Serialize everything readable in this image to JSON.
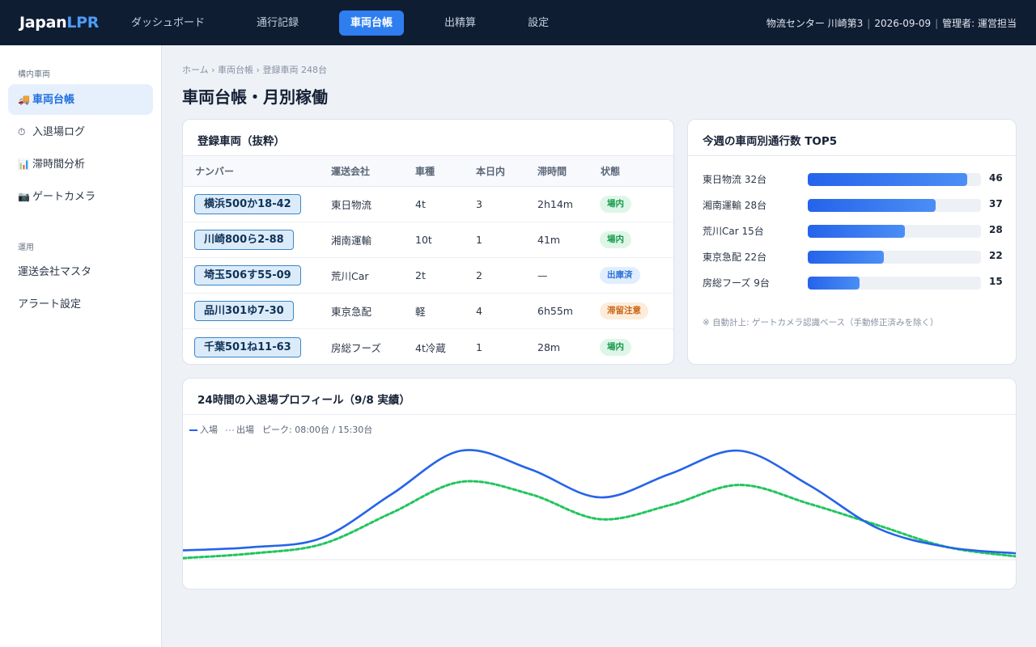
{
  "brand": {
    "prefix": "Japan",
    "accent": "LPR"
  },
  "nav": [
    {
      "label": "ダッシュボード",
      "active": false
    },
    {
      "label": "通行記録",
      "active": false
    },
    {
      "label": "車両台帳",
      "active": true
    },
    {
      "label": "出精算",
      "active": false
    },
    {
      "label": "設定",
      "active": false
    }
  ],
  "topmeta": {
    "site": "物流センター 川崎第3",
    "sep": "|",
    "date": "2026-09-09",
    "user": "管理者: 運営担当"
  },
  "sidebar": {
    "section1": "構内車両",
    "items1": [
      {
        "icon": "🚚",
        "icon_name": "truck-icon",
        "label": "車両台帳",
        "active": true
      },
      {
        "icon": "⏱",
        "icon_name": "timer-icon",
        "label": "入退場ログ",
        "active": false
      },
      {
        "icon": "📊",
        "icon_name": "bar-chart-icon",
        "label": "滞時間分析",
        "active": false
      },
      {
        "icon": "📷",
        "icon_name": "camera-icon",
        "label": "ゲートカメラ",
        "active": false
      }
    ],
    "section2": "運用",
    "items2": [
      {
        "label": "運送会社マスタ"
      },
      {
        "label": "アラート設定"
      }
    ]
  },
  "breadcrumb": "ホーム › 車両台帳 › 登録車両 248台",
  "page_title": "車両台帳・月別稼働",
  "vehicles": {
    "title": "登録車両（抜粋）",
    "columns": [
      "ナンバー",
      "運送会社",
      "車種",
      "本日内",
      "滞時間",
      "状態"
    ],
    "rows": [
      {
        "plate": "横浜500か18-42",
        "company": "東日物流",
        "type": "4t",
        "today": "3",
        "dwell": "2h14m",
        "status": "場内",
        "status_color": "green"
      },
      {
        "plate": "川崎800ら2-88",
        "company": "湘南運輸",
        "type": "10t",
        "today": "1",
        "dwell": "41m",
        "status": "場内",
        "status_color": "green"
      },
      {
        "plate": "埼玉506す55-09",
        "company": "荒川Car",
        "type": "2t",
        "today": "2",
        "dwell": "—",
        "status": "出庫済",
        "status_color": "blue"
      },
      {
        "plate": "品川301ゆ7-30",
        "company": "東京急配",
        "type": "軽",
        "today": "4",
        "dwell": "6h55m",
        "status": "滞留注意",
        "status_color": "orange"
      },
      {
        "plate": "千葉501ね11-63",
        "company": "房総フーズ",
        "type": "4t冷蔵",
        "today": "1",
        "dwell": "28m",
        "status": "場内",
        "status_color": "green"
      }
    ]
  },
  "top5": {
    "title": "今週の車両別通行数 TOP5",
    "max": 46,
    "items": [
      {
        "label": "東日物流 32台",
        "value": 46
      },
      {
        "label": "湘南運輸 28台",
        "value": 37
      },
      {
        "label": "荒川Car 15台",
        "value": 28
      },
      {
        "label": "東京急配 22台",
        "value": 22
      },
      {
        "label": "房総フーズ 9台",
        "value": 15
      }
    ],
    "note": "※ 自動計上: ゲートカメラ認識ベース（手動修正済みを除く）"
  },
  "profile": {
    "title": "24時間の入退場プロフィール（9/8 実績）",
    "legend": {
      "in": "入場",
      "out": "出場",
      "peak": "ピーク: 08:00台 / 15:30台"
    }
  },
  "chart_data": {
    "type": "line",
    "title": "24時間の入退場プロフィール（9/8 実績）",
    "x": [
      0,
      2,
      4,
      6,
      8,
      10,
      12,
      14,
      16,
      18,
      20,
      22,
      24
    ],
    "series": [
      {
        "name": "入場",
        "color": "#2563eb",
        "style": "solid",
        "values": [
          6,
          8,
          14,
          42,
          70,
          58,
          40,
          55,
          70,
          48,
          20,
          8,
          4
        ]
      },
      {
        "name": "出場",
        "color": "#22c55e",
        "style": "dotted",
        "values": [
          1,
          4,
          10,
          30,
          50,
          42,
          26,
          35,
          48,
          36,
          22,
          8,
          2
        ]
      }
    ],
    "ylim": [
      0,
      80
    ],
    "grid": false,
    "legend": "top-left"
  }
}
